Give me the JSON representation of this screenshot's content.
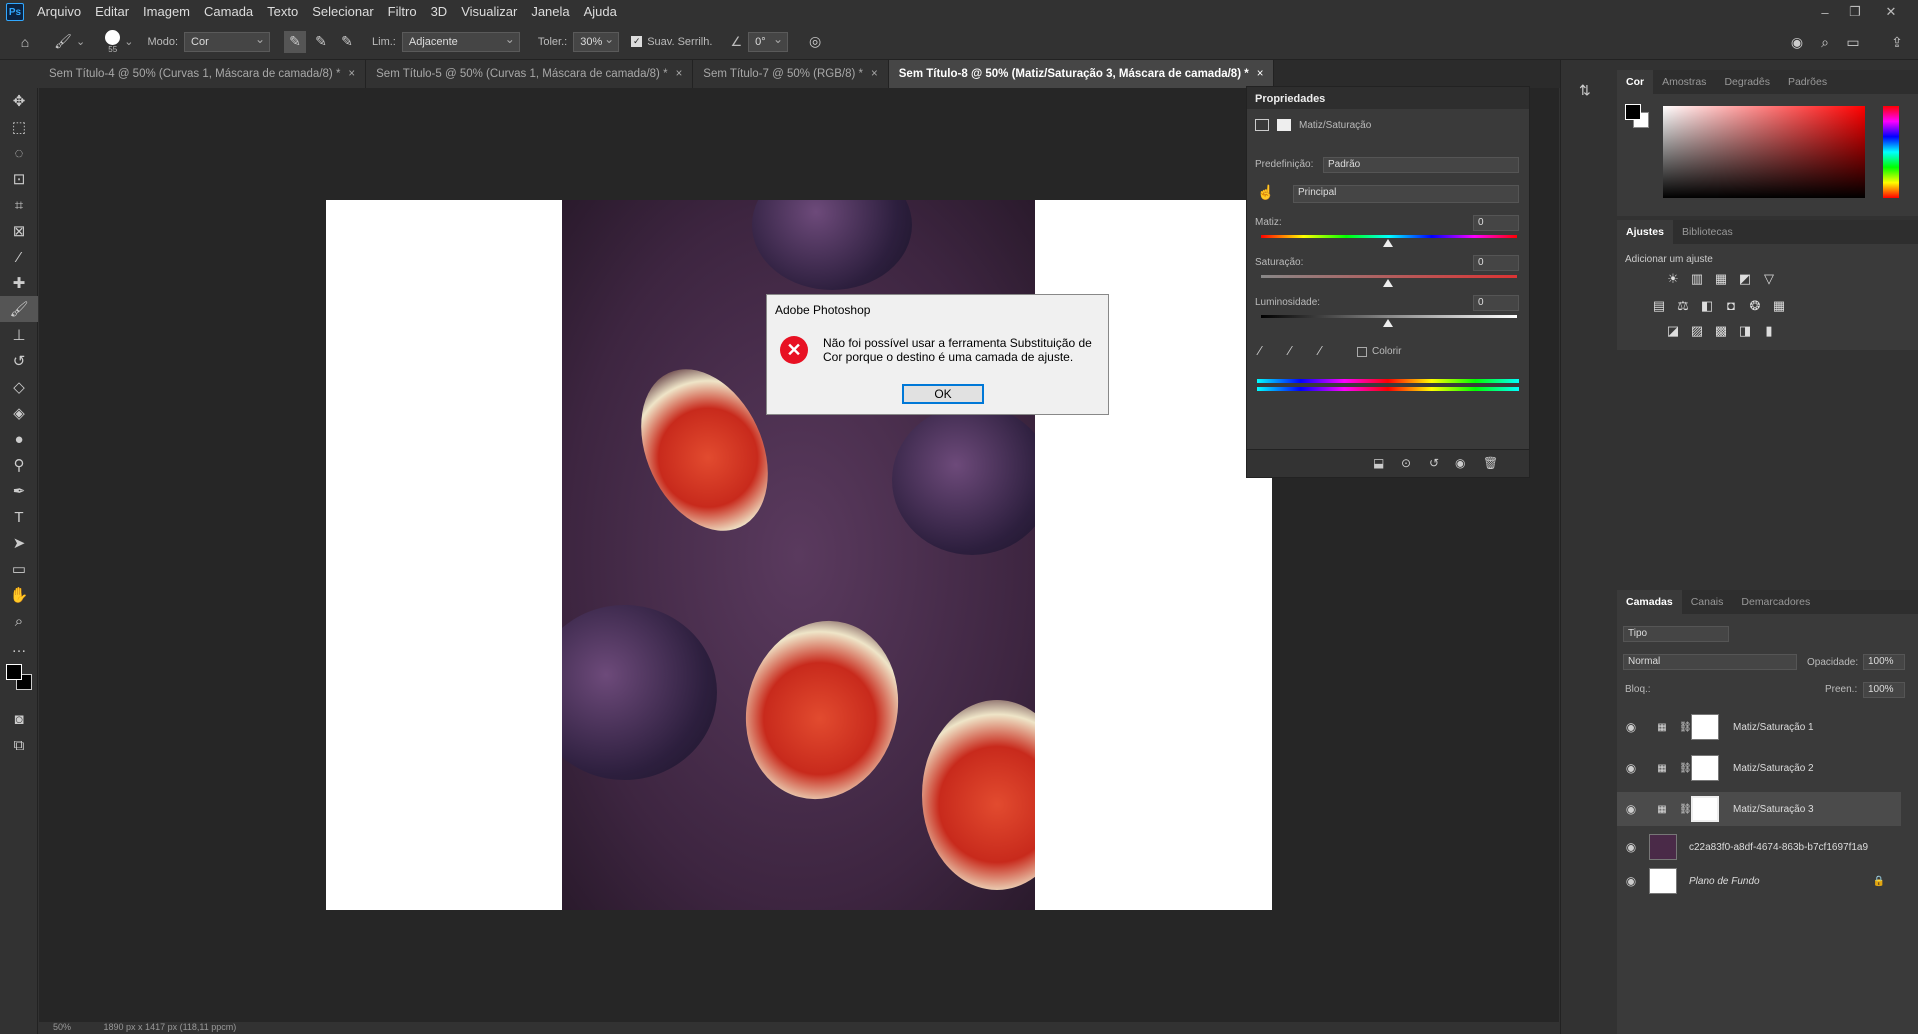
{
  "menubar": {
    "logo": "Ps",
    "items": [
      "Arquivo",
      "Editar",
      "Imagem",
      "Camada",
      "Texto",
      "Selecionar",
      "Filtro",
      "3D",
      "Visualizar",
      "Janela",
      "Ajuda"
    ]
  },
  "options_bar": {
    "brush_size": "55",
    "mode_label": "Modo:",
    "mode_value": "Cor",
    "limits_label": "Lim.:",
    "limits_value": "Adjacente",
    "tolerance_label": "Toler.:",
    "tolerance_value": "30%",
    "antialias_label": "Suav. Serrilh.",
    "angle_value": "0°"
  },
  "tabs": [
    {
      "label": "Sem Título-4 @ 50% (Curvas 1, Máscara de camada/8) *",
      "active": false
    },
    {
      "label": "Sem Título-5 @ 50% (Curvas 1, Máscara de camada/8) *",
      "active": false
    },
    {
      "label": "Sem Título-7 @ 50% (RGB/8) *",
      "active": false
    },
    {
      "label": "Sem Título-8 @ 50% (Matiz/Saturação 3, Máscara de camada/8) *",
      "active": true
    }
  ],
  "status": {
    "zoom": "50%",
    "doc_info": "1890 px x 1417 px (118,11 ppcm)"
  },
  "dialog": {
    "title": "Adobe Photoshop",
    "message": "Não foi possível usar a ferramenta Substituição de Cor porque o destino é uma camada de ajuste.",
    "ok_label": "OK"
  },
  "properties": {
    "title": "Propriedades",
    "adjustment_name": "Matiz/Saturação",
    "preset_label": "Predefinição:",
    "preset_value": "Padrão",
    "channel_value": "Principal",
    "hue_label": "Matiz:",
    "hue_value": "0",
    "saturation_label": "Saturação:",
    "saturation_value": "0",
    "lightness_label": "Luminosidade:",
    "lightness_value": "0",
    "colorize_label": "Colorir"
  },
  "color_panel": {
    "tabs": [
      "Cor",
      "Amostras",
      "Degradês",
      "Padrões"
    ],
    "foreground": "#000000",
    "background": "#ffffff",
    "hue_color": "#ff0000"
  },
  "adjustments_panel": {
    "tabs": [
      "Ajustes",
      "Bibliotecas"
    ],
    "add_label": "Adicionar um ajuste"
  },
  "layers_panel": {
    "tabs": [
      "Camadas",
      "Canais",
      "Demarcadores"
    ],
    "filter_value": "Tipo",
    "blend_mode": "Normal",
    "opacity_label": "Opacidade:",
    "opacity_value": "100%",
    "lock_label": "Bloq.:",
    "fill_label": "Preen.:",
    "fill_value": "100%",
    "layers": [
      {
        "name": "Matiz/Saturação 1",
        "selected": false
      },
      {
        "name": "Matiz/Saturação 2",
        "selected": false
      },
      {
        "name": "Matiz/Saturação 3",
        "selected": true
      },
      {
        "name": "c22a83f0-a8df-4674-863b-b7cf1697f1a9",
        "selected": false
      },
      {
        "name": "Plano de Fundo",
        "selected": false
      }
    ]
  }
}
